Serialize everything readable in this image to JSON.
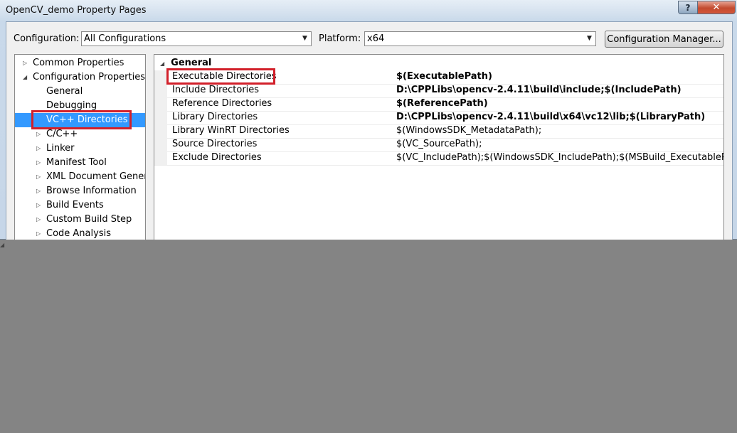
{
  "window": {
    "title": "OpenCV_demo Property Pages",
    "help_label": "?",
    "close_label": "✕"
  },
  "toolbar": {
    "configuration_label": "Configuration:",
    "configuration_value": "All Configurations",
    "platform_label": "Platform:",
    "platform_value": "x64",
    "config_manager_label": "Configuration Manager..."
  },
  "tree": [
    {
      "label": "Common Properties",
      "expander": "▷",
      "level": 0,
      "selected": false
    },
    {
      "label": "Configuration Properties",
      "expander": "◢",
      "level": 0,
      "selected": false
    },
    {
      "label": "General",
      "expander": "",
      "level": 1,
      "selected": false
    },
    {
      "label": "Debugging",
      "expander": "",
      "level": 1,
      "selected": false
    },
    {
      "label": "VC++ Directories",
      "expander": "",
      "level": 1,
      "selected": true
    },
    {
      "label": "C/C++",
      "expander": "▷",
      "level": 1,
      "selected": false
    },
    {
      "label": "Linker",
      "expander": "▷",
      "level": 1,
      "selected": false
    },
    {
      "label": "Manifest Tool",
      "expander": "▷",
      "level": 1,
      "selected": false
    },
    {
      "label": "XML Document Generat",
      "expander": "▷",
      "level": 1,
      "selected": false
    },
    {
      "label": "Browse Information",
      "expander": "▷",
      "level": 1,
      "selected": false
    },
    {
      "label": "Build Events",
      "expander": "▷",
      "level": 1,
      "selected": false
    },
    {
      "label": "Custom Build Step",
      "expander": "▷",
      "level": 1,
      "selected": false
    },
    {
      "label": "Code Analysis",
      "expander": "▷",
      "level": 1,
      "selected": false
    }
  ],
  "grid": {
    "category_expander": "◢",
    "category": "General",
    "rows": [
      {
        "name": "Executable Directories",
        "value": "$(ExecutablePath)",
        "bold": true
      },
      {
        "name": "Include Directories",
        "value": "D:\\CPPLibs\\opencv-2.4.11\\build\\include;$(IncludePath)",
        "bold": true
      },
      {
        "name": "Reference Directories",
        "value": "$(ReferencePath)",
        "bold": true
      },
      {
        "name": "Library Directories",
        "value": "D:\\CPPLibs\\opencv-2.4.11\\build\\x64\\vc12\\lib;$(LibraryPath)",
        "bold": true
      },
      {
        "name": "Library WinRT Directories",
        "value": "$(WindowsSDK_MetadataPath);",
        "bold": false
      },
      {
        "name": "Source Directories",
        "value": "$(VC_SourcePath);",
        "bold": false
      },
      {
        "name": "Exclude Directories",
        "value": "$(VC_IncludePath);$(WindowsSDK_IncludePath);$(MSBuild_ExecutablePath);$(VC_",
        "bold": false
      }
    ]
  },
  "colors": {
    "highlight": "#3399ff",
    "annotation": "#d2202a"
  }
}
